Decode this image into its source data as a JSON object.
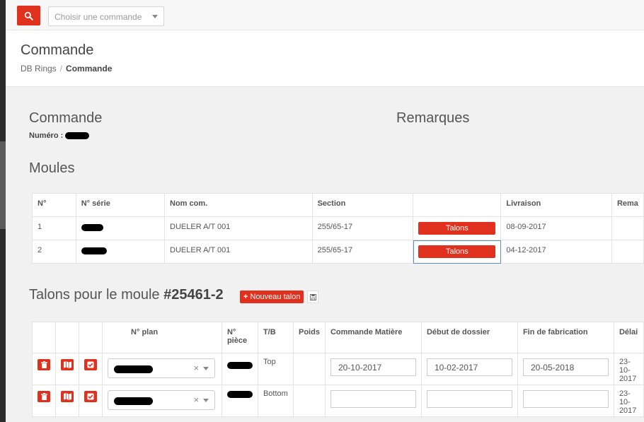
{
  "topbar": {
    "command_select_placeholder": "Choisir une commande"
  },
  "header": {
    "title": "Commande",
    "breadcrumb": [
      "DB Rings",
      "Commande"
    ]
  },
  "commande": {
    "heading": "Commande",
    "numero_label": "Numéro :",
    "remarques_heading": "Remarques"
  },
  "moules": {
    "heading": "Moules",
    "columns": [
      "N°",
      "N° série",
      "Nom com.",
      "Section",
      "",
      "Livraison",
      "Rema"
    ],
    "rows": [
      {
        "n": "1",
        "nom": "DUELER A/T 001",
        "section": "255/65-17",
        "button": "Talons",
        "livraison": "08-09-2017"
      },
      {
        "n": "2",
        "nom": "DUELER A/T 001",
        "section": "255/65-17",
        "button": "Talons",
        "livraison": "04-12-2017"
      }
    ]
  },
  "talons": {
    "heading_prefix": "Talons pour le moule",
    "moule_id": "#25461-2",
    "new_button": "Nouveau talon",
    "columns": [
      "N° plan",
      "N° pièce",
      "T/B",
      "Poids",
      "Commande Matière",
      "Début de dossier",
      "Fin de fabrication",
      "Délai"
    ],
    "rows": [
      {
        "tb": "Top",
        "poids": "",
        "commande_matiere": "20-10-2017",
        "debut_dossier": "10-02-2017",
        "fin_fabrication": "20-05-2018",
        "delai": "23-10-2017"
      },
      {
        "tb": "Bottom",
        "poids": "",
        "commande_matiere": "",
        "debut_dossier": "",
        "fin_fabrication": "",
        "delai": "23-10-2017"
      }
    ]
  },
  "colors": {
    "accent": "#e0301e",
    "selection": "#5b8fc7"
  },
  "icons": [
    "search-icon",
    "chevron-down-icon",
    "plus-icon",
    "save-icon",
    "trash-icon",
    "map-icon",
    "check-square-icon",
    "clear-icon"
  ]
}
